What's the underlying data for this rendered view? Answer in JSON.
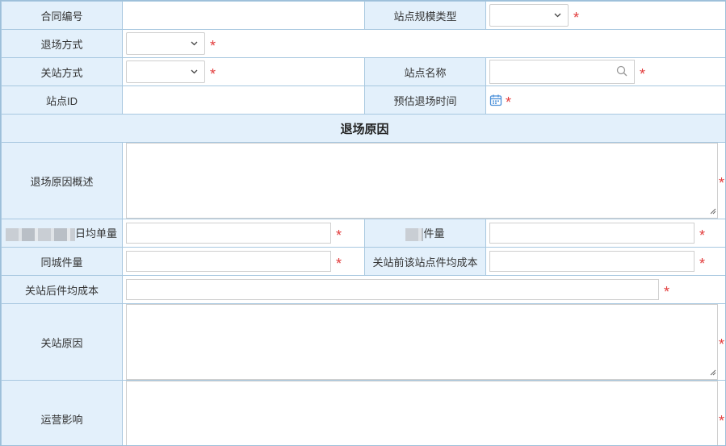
{
  "form": {
    "contract_no_label": "合同编号",
    "site_scale_type_label": "站点规模类型",
    "exit_method_label": "退场方式",
    "close_method_label": "关站方式",
    "site_name_label": "站点名称",
    "site_id_label": "站点ID",
    "est_exit_time_label": "预估退场时间",
    "exit_reason_section": "退场原因",
    "exit_reason_summary_label": "退场原因概述",
    "daily_avg_orders_label_suffix": "日均单量",
    "piece_volume_label_suffix": "件量",
    "same_city_volume_label": "同城件量",
    "avg_cost_before_close_label": "关站前该站点件均成本",
    "avg_cost_after_close_label": "关站后件均成本",
    "close_reason_label": "关站原因",
    "operation_impact_label": "运营影响",
    "required_mark": "*"
  },
  "icons": {
    "select": "chevron-down-icon",
    "search": "search-icon",
    "date": "calendar-icon",
    "resize": "resize-grip-icon"
  },
  "colors": {
    "label_bg": "#e3f0fb",
    "border": "#a8c8e0",
    "required": "#e23b3b",
    "calendar": "#4a90d9"
  }
}
